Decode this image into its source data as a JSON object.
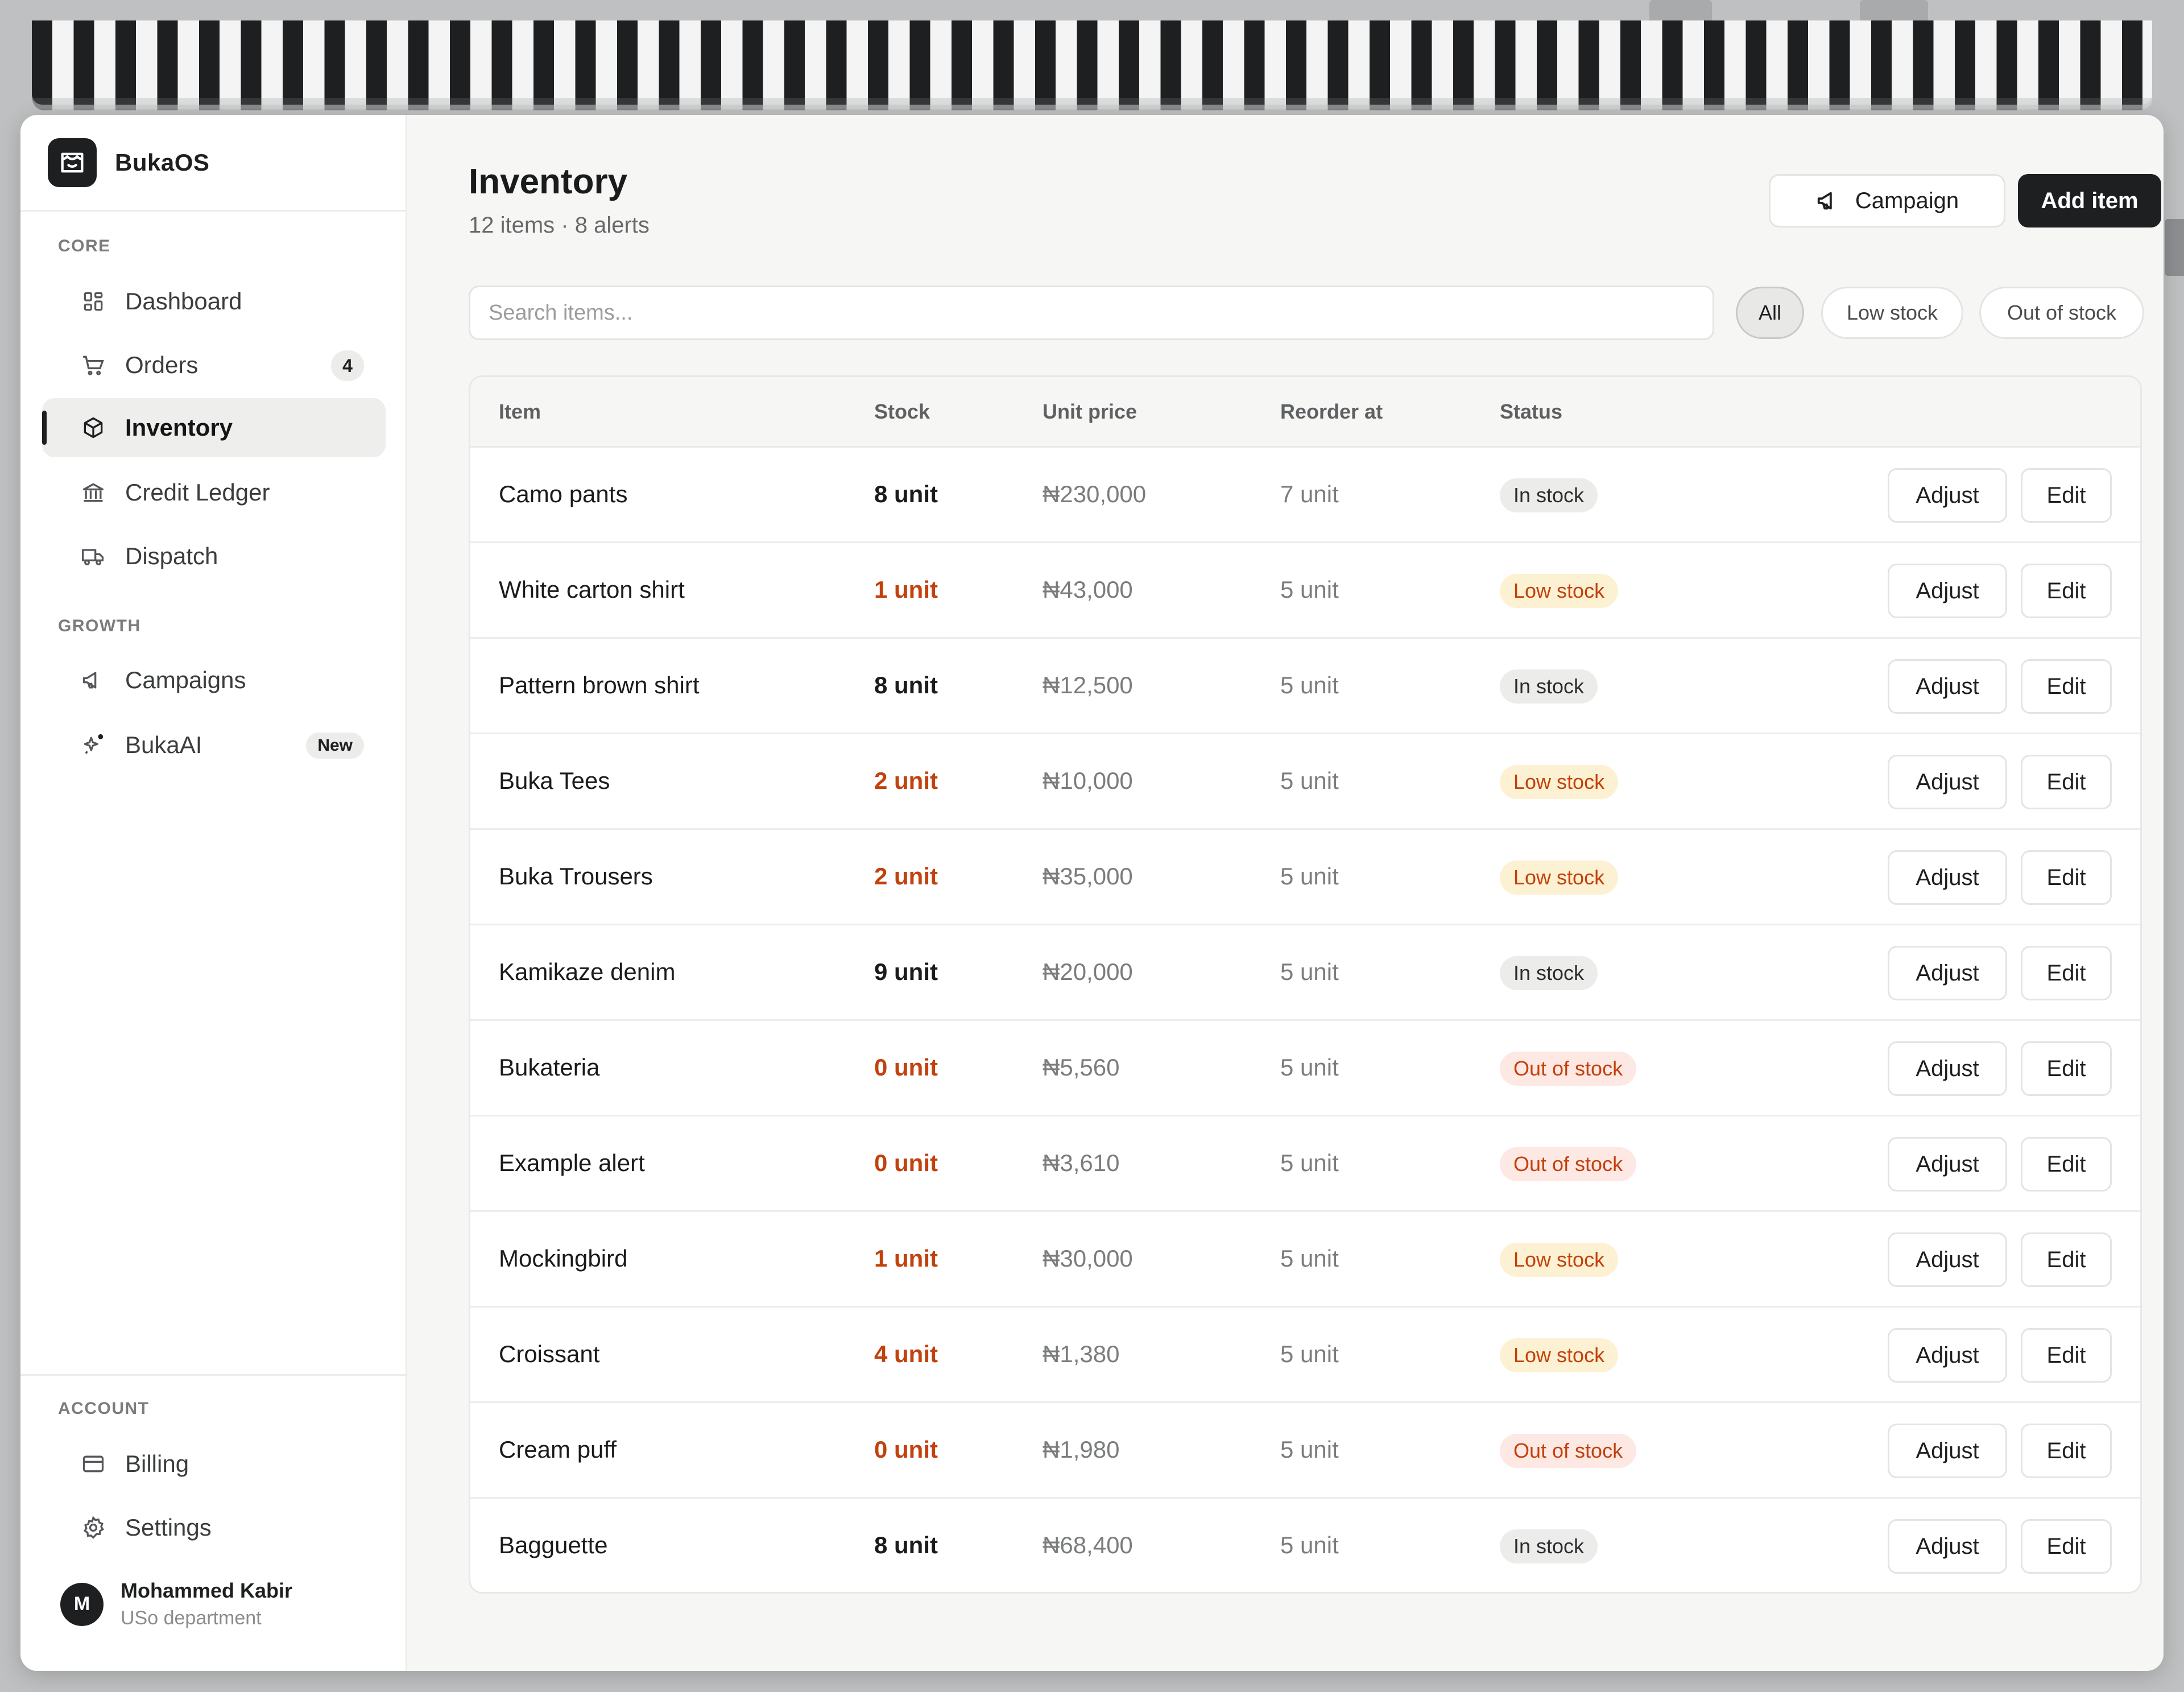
{
  "app": {
    "name": "BukaOS"
  },
  "sidebar": {
    "sections": {
      "core": "CORE",
      "growth": "GROWTH",
      "account": "ACCOUNT"
    },
    "items": [
      {
        "label": "Dashboard",
        "icon": "grid-icon"
      },
      {
        "label": "Orders",
        "icon": "cart-icon",
        "badge": "4"
      },
      {
        "label": "Inventory",
        "icon": "box-icon",
        "active": true
      },
      {
        "label": "Credit Ledger",
        "icon": "bank-icon"
      },
      {
        "label": "Dispatch",
        "icon": "truck-icon"
      },
      {
        "label": "Campaigns",
        "icon": "megaphone-icon"
      },
      {
        "label": "BukaAI",
        "icon": "sparkle-icon",
        "badge": "New"
      },
      {
        "label": "Billing",
        "icon": "card-icon"
      },
      {
        "label": "Settings",
        "icon": "gear-icon"
      }
    ],
    "user": {
      "initial": "M",
      "name": "Mohammed Kabir",
      "department": "USo department"
    }
  },
  "header": {
    "title": "Inventory",
    "subtitle": "12 items · 8 alerts",
    "campaign_label": "Campaign",
    "add_label": "Add item"
  },
  "search": {
    "placeholder": "Search items..."
  },
  "filters": [
    "All",
    "Low stock",
    "Out of stock"
  ],
  "table": {
    "columns": [
      "Item",
      "Stock",
      "Unit price",
      "Reorder at",
      "Status"
    ],
    "adjust_label": "Adjust",
    "edit_label": "Edit",
    "rows": [
      {
        "item": "Camo pants",
        "stock": "8 unit",
        "price": "₦230,000",
        "reorder": "7 unit",
        "status": "In stock"
      },
      {
        "item": "White carton shirt",
        "stock": "1 unit",
        "price": "₦43,000",
        "reorder": "5 unit",
        "status": "Low stock"
      },
      {
        "item": "Pattern brown shirt",
        "stock": "8 unit",
        "price": "₦12,500",
        "reorder": "5 unit",
        "status": "In stock"
      },
      {
        "item": "Buka Tees",
        "stock": "2 unit",
        "price": "₦10,000",
        "reorder": "5 unit",
        "status": "Low stock"
      },
      {
        "item": "Buka Trousers",
        "stock": "2 unit",
        "price": "₦35,000",
        "reorder": "5 unit",
        "status": "Low stock"
      },
      {
        "item": "Kamikaze denim",
        "stock": "9 unit",
        "price": "₦20,000",
        "reorder": "5 unit",
        "status": "In stock"
      },
      {
        "item": "Bukateria",
        "stock": "0 unit",
        "price": "₦5,560",
        "reorder": "5 unit",
        "status": "Out of stock"
      },
      {
        "item": "Example alert",
        "stock": "0 unit",
        "price": "₦3,610",
        "reorder": "5 unit",
        "status": "Out of stock"
      },
      {
        "item": "Mockingbird",
        "stock": "1 unit",
        "price": "₦30,000",
        "reorder": "5 unit",
        "status": "Low stock"
      },
      {
        "item": "Croissant",
        "stock": "4 unit",
        "price": "₦1,380",
        "reorder": "5 unit",
        "status": "Low stock"
      },
      {
        "item": "Cream puff",
        "stock": "0 unit",
        "price": "₦1,980",
        "reorder": "5 unit",
        "status": "Out of stock"
      },
      {
        "item": "Bagguette",
        "stock": "8 unit",
        "price": "₦68,400",
        "reorder": "5 unit",
        "status": "In stock"
      }
    ]
  },
  "colors": {
    "accent_dark": "#1e1f20",
    "alert_text": "#c2410c",
    "low_stock_bg": "#fdf1d3",
    "out_of_stock_bg": "#fde8e4"
  }
}
